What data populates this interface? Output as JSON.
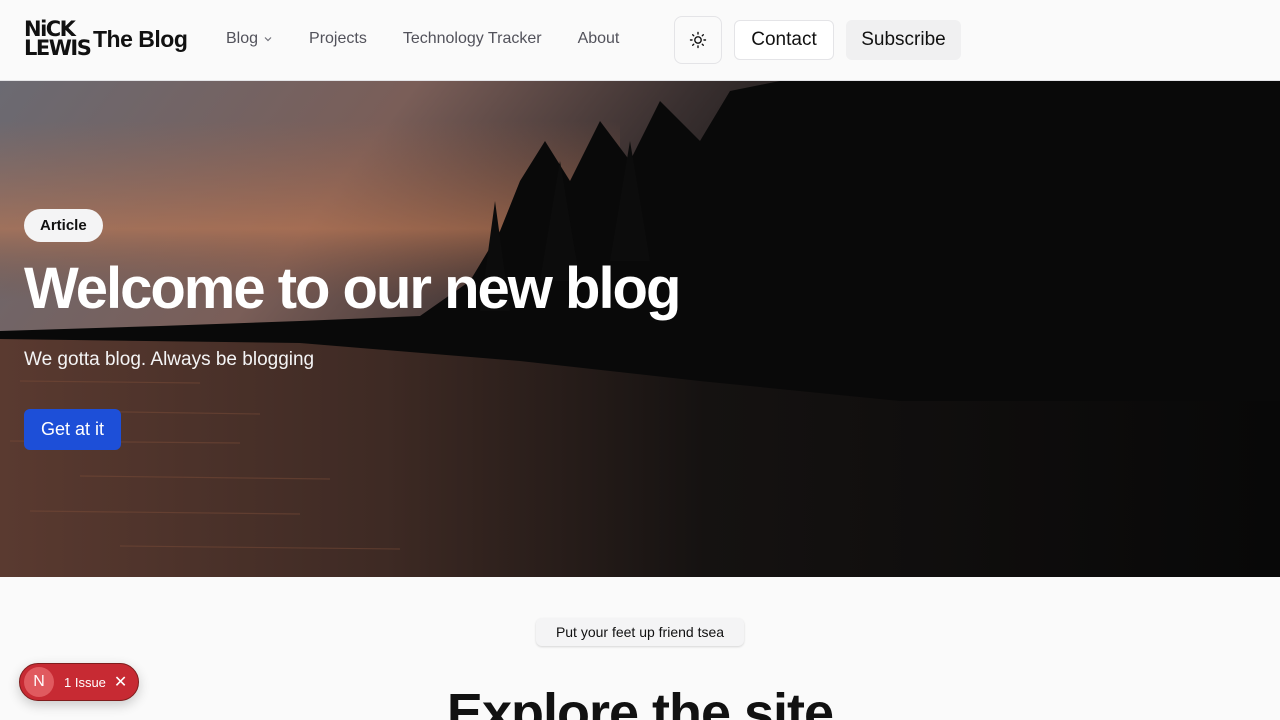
{
  "logo": {
    "line1": "NiCK",
    "line2": "LEWIS"
  },
  "header": {
    "title": "The Blog",
    "nav": [
      {
        "label": "Blog",
        "has_dropdown": true
      },
      {
        "label": "Projects"
      },
      {
        "label": "Technology Tracker"
      },
      {
        "label": "About"
      }
    ],
    "theme_icon": "sun-icon",
    "contact_label": "Contact",
    "subscribe_label": "Subscribe"
  },
  "hero": {
    "badge": "Article",
    "title": "Welcome to our new blog",
    "subtitle": "We gotta blog. Always be blogging",
    "cta_label": "Get at it"
  },
  "section": {
    "pill": "Put your feet up friend tsea",
    "heading": "Explore the site"
  },
  "issue_toast": {
    "icon_letter": "N",
    "label": "1 Issue",
    "close": "✕"
  },
  "colors": {
    "accent": "#1d4fd8",
    "issue_red": "#c72a33"
  }
}
